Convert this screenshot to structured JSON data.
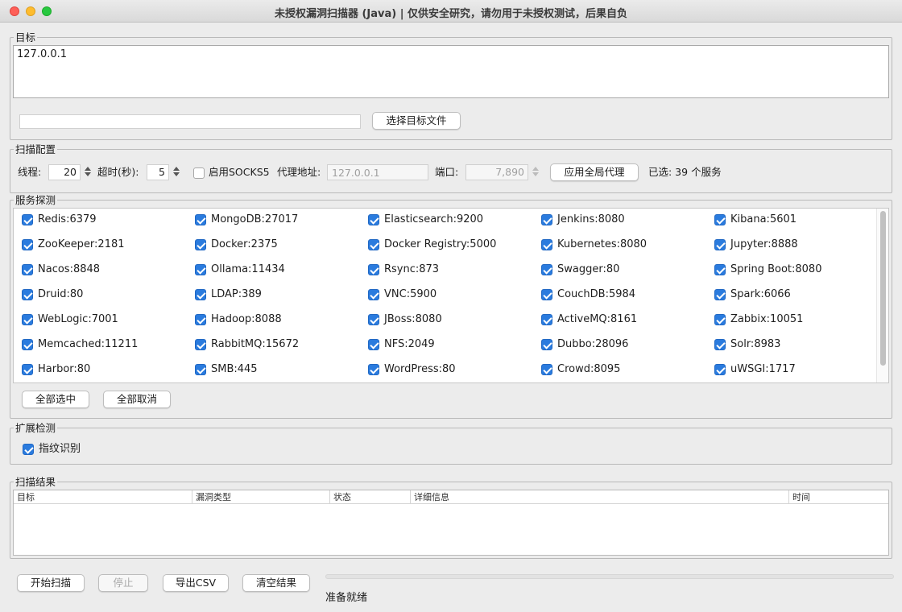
{
  "window": {
    "title": "未授权漏洞扫描器 (Java) | 仅供安全研究，请勿用于未授权测试，后果自负"
  },
  "target": {
    "group_title": "目标",
    "text": "127.0.0.1",
    "file_path": "",
    "choose_file_label": "选择目标文件"
  },
  "scan_config": {
    "group_title": "扫描配置",
    "threads_label": "线程:",
    "threads_value": "20",
    "timeout_label": "超时(秒):",
    "timeout_value": "5",
    "socks5_label": "启用SOCKS5",
    "socks5_checked": false,
    "proxy_addr_label": "代理地址:",
    "proxy_addr_placeholder": "127.0.0.1",
    "port_label": "端口:",
    "port_value": "7,890",
    "apply_proxy_label": "应用全局代理",
    "selected_summary": "已选: 39 个服务"
  },
  "services": {
    "group_title": "服务探测",
    "items": [
      {
        "label": "Redis:6379",
        "checked": true
      },
      {
        "label": "MongoDB:27017",
        "checked": true
      },
      {
        "label": "Elasticsearch:9200",
        "checked": true
      },
      {
        "label": "Jenkins:8080",
        "checked": true
      },
      {
        "label": "Kibana:5601",
        "checked": true
      },
      {
        "label": "ZooKeeper:2181",
        "checked": true
      },
      {
        "label": "Docker:2375",
        "checked": true
      },
      {
        "label": "Docker Registry:5000",
        "checked": true
      },
      {
        "label": "Kubernetes:8080",
        "checked": true
      },
      {
        "label": "Jupyter:8888",
        "checked": true
      },
      {
        "label": "Nacos:8848",
        "checked": true
      },
      {
        "label": "Ollama:11434",
        "checked": true
      },
      {
        "label": "Rsync:873",
        "checked": true
      },
      {
        "label": "Swagger:80",
        "checked": true
      },
      {
        "label": "Spring Boot:8080",
        "checked": true
      },
      {
        "label": "Druid:80",
        "checked": true
      },
      {
        "label": "LDAP:389",
        "checked": true
      },
      {
        "label": "VNC:5900",
        "checked": true
      },
      {
        "label": "CouchDB:5984",
        "checked": true
      },
      {
        "label": "Spark:6066",
        "checked": true
      },
      {
        "label": "WebLogic:7001",
        "checked": true
      },
      {
        "label": "Hadoop:8088",
        "checked": true
      },
      {
        "label": "JBoss:8080",
        "checked": true
      },
      {
        "label": "ActiveMQ:8161",
        "checked": true
      },
      {
        "label": "Zabbix:10051",
        "checked": true
      },
      {
        "label": "Memcached:11211",
        "checked": true
      },
      {
        "label": "RabbitMQ:15672",
        "checked": true
      },
      {
        "label": "NFS:2049",
        "checked": true
      },
      {
        "label": "Dubbo:28096",
        "checked": true
      },
      {
        "label": "Solr:8983",
        "checked": true
      },
      {
        "label": "Harbor:80",
        "checked": true
      },
      {
        "label": "SMB:445",
        "checked": true
      },
      {
        "label": "WordPress:80",
        "checked": true
      },
      {
        "label": "Crowd:8095",
        "checked": true
      },
      {
        "label": "uWSGI:1717",
        "checked": true
      }
    ],
    "select_all_label": "全部选中",
    "deselect_all_label": "全部取消"
  },
  "extended": {
    "group_title": "扩展检测",
    "fingerprint_label": "指纹识别",
    "fingerprint_checked": true
  },
  "results": {
    "group_title": "扫描结果",
    "columns": [
      "目标",
      "漏洞类型",
      "状态",
      "详细信息",
      "时间"
    ]
  },
  "actions": {
    "start_label": "开始扫描",
    "stop_label": "停止",
    "export_label": "导出CSV",
    "clear_label": "清空结果"
  },
  "status": {
    "text": "准备就绪",
    "progress": 0
  },
  "colors": {
    "checkbox_accent": "#2a7bde",
    "window_bg": "#ececec"
  }
}
